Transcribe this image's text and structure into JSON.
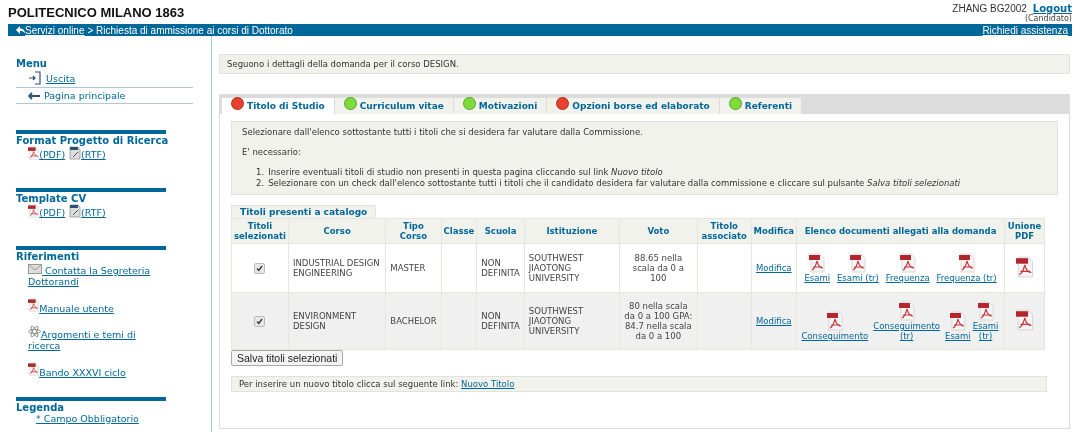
{
  "header": {
    "logo": "POLITECNICO MILANO 1863",
    "user": "ZHANG BG2002",
    "logout": "Logout",
    "role": "(Candidato)"
  },
  "breadcrumb": {
    "link": "Servizi online",
    "path": "> Richiesta di ammissione ai corsi di Dottorato",
    "assistance": "Richiedi assistenza"
  },
  "sidebar": [
    {
      "title": "Menu",
      "kind": "menu",
      "items": [
        {
          "kind": "exit",
          "label": "Uscita"
        },
        {
          "kind": "back",
          "label": "Pagina principale"
        }
      ]
    },
    {
      "title": "Format Progetto di Ricerca",
      "kind": "inline",
      "items": [
        {
          "kind": "pdf",
          "label": "(PDF)"
        },
        {
          "kind": "rtf",
          "label": "(RTF)"
        }
      ]
    },
    {
      "title": "Template CV",
      "kind": "inline",
      "items": [
        {
          "kind": "pdf",
          "label": "(PDF)"
        },
        {
          "kind": "rtf",
          "label": "(RTF)"
        }
      ]
    },
    {
      "title": "Riferimenti",
      "kind": "blocks",
      "items": [
        {
          "kind": "mail",
          "label": " Contatta la Segreteria Dottorandi"
        },
        {
          "kind": "pdf",
          "label": "Manuale utente"
        },
        {
          "kind": "atom",
          "label": "Argomenti e temi di ricerca"
        },
        {
          "kind": "pdf",
          "label": "Bando XXXVI ciclo"
        }
      ]
    },
    {
      "title": "Legenda",
      "kind": "legend",
      "items": [
        {
          "label": "* Campo Obbligatorio"
        }
      ]
    }
  ],
  "notice": "Seguono i dettagli della domanda per il corso DESIGN.",
  "tabs": [
    {
      "label": "Titolo di Studio",
      "color": "#e8412f",
      "selected": true
    },
    {
      "label": "Curriculum vitae",
      "color": "#7ddc3c",
      "selected": false
    },
    {
      "label": "Motivazioni",
      "color": "#7ddc3c",
      "selected": false
    },
    {
      "label": "Opzioni borse ed elaborato",
      "color": "#e8412f",
      "selected": false
    },
    {
      "label": "Referenti",
      "color": "#7ddc3c",
      "selected": false
    }
  ],
  "instructions": {
    "intro": "Selezionare dall'elenco sottostante tutti i titoli che si desidera far valutare dalla Commissione.",
    "required": "E' necessario:",
    "steps": [
      {
        "marker": "1.",
        "text": "Inserire eventuali titoli di studio non presenti in questa pagina cliccando sul link *Nuovo titolo*"
      },
      {
        "marker": "2.",
        "text": "Selezionare con un check dall'elenco sottostante tutti i titoli che il candidato desidera far valutare dalla commissione e cliccare sul pulsante *Salva titoli selezionati*"
      }
    ]
  },
  "table": {
    "caption": "Titoli presenti a catalogo",
    "columns": [
      "Titoli selezionati",
      "Corso",
      "Tipo Corso",
      "Classe",
      "Scuola",
      "Istituzione",
      "Voto",
      "Titolo associato",
      "Modifica",
      "Elenco documenti allegati alla domanda",
      "Unione PDF"
    ],
    "rows": [
      {
        "checked": true,
        "corso": "INDUSTRIAL DESIGN ENGINEERING",
        "tipo": "MASTER",
        "scuola": "NON DEFINITA",
        "istituzione": "SOUTHWEST JIAOTONG UNIVERSITY",
        "voto": "88.65 nella scala da 0 a 100",
        "edit": "Modifica",
        "documents": [
          "Esami",
          "Esami (tr)",
          "Frequenza",
          "Frequenza (tr)"
        ]
      },
      {
        "checked": true,
        "corso": "ENVIRONMENT DESIGN",
        "tipo": "BACHELOR",
        "scuola": "NON DEFINITA",
        "istituzione": "SOUTHWEST JIAOTONG UNIVERSITY",
        "voto": "80 nella scala da 0 a 100 GPA: 84.7 nella scala da 0 a 100",
        "edit": "Modifica",
        "documents": [
          "Conseguimento",
          "Conseguimento (tr)",
          "Esami",
          "Esami (tr)"
        ]
      }
    ]
  },
  "save_button": "Salva titoli selezionati",
  "new_title": {
    "text": "Per inserire un nuovo titolo clicca sul seguente link:",
    "link": "Nuovo Titolo"
  }
}
